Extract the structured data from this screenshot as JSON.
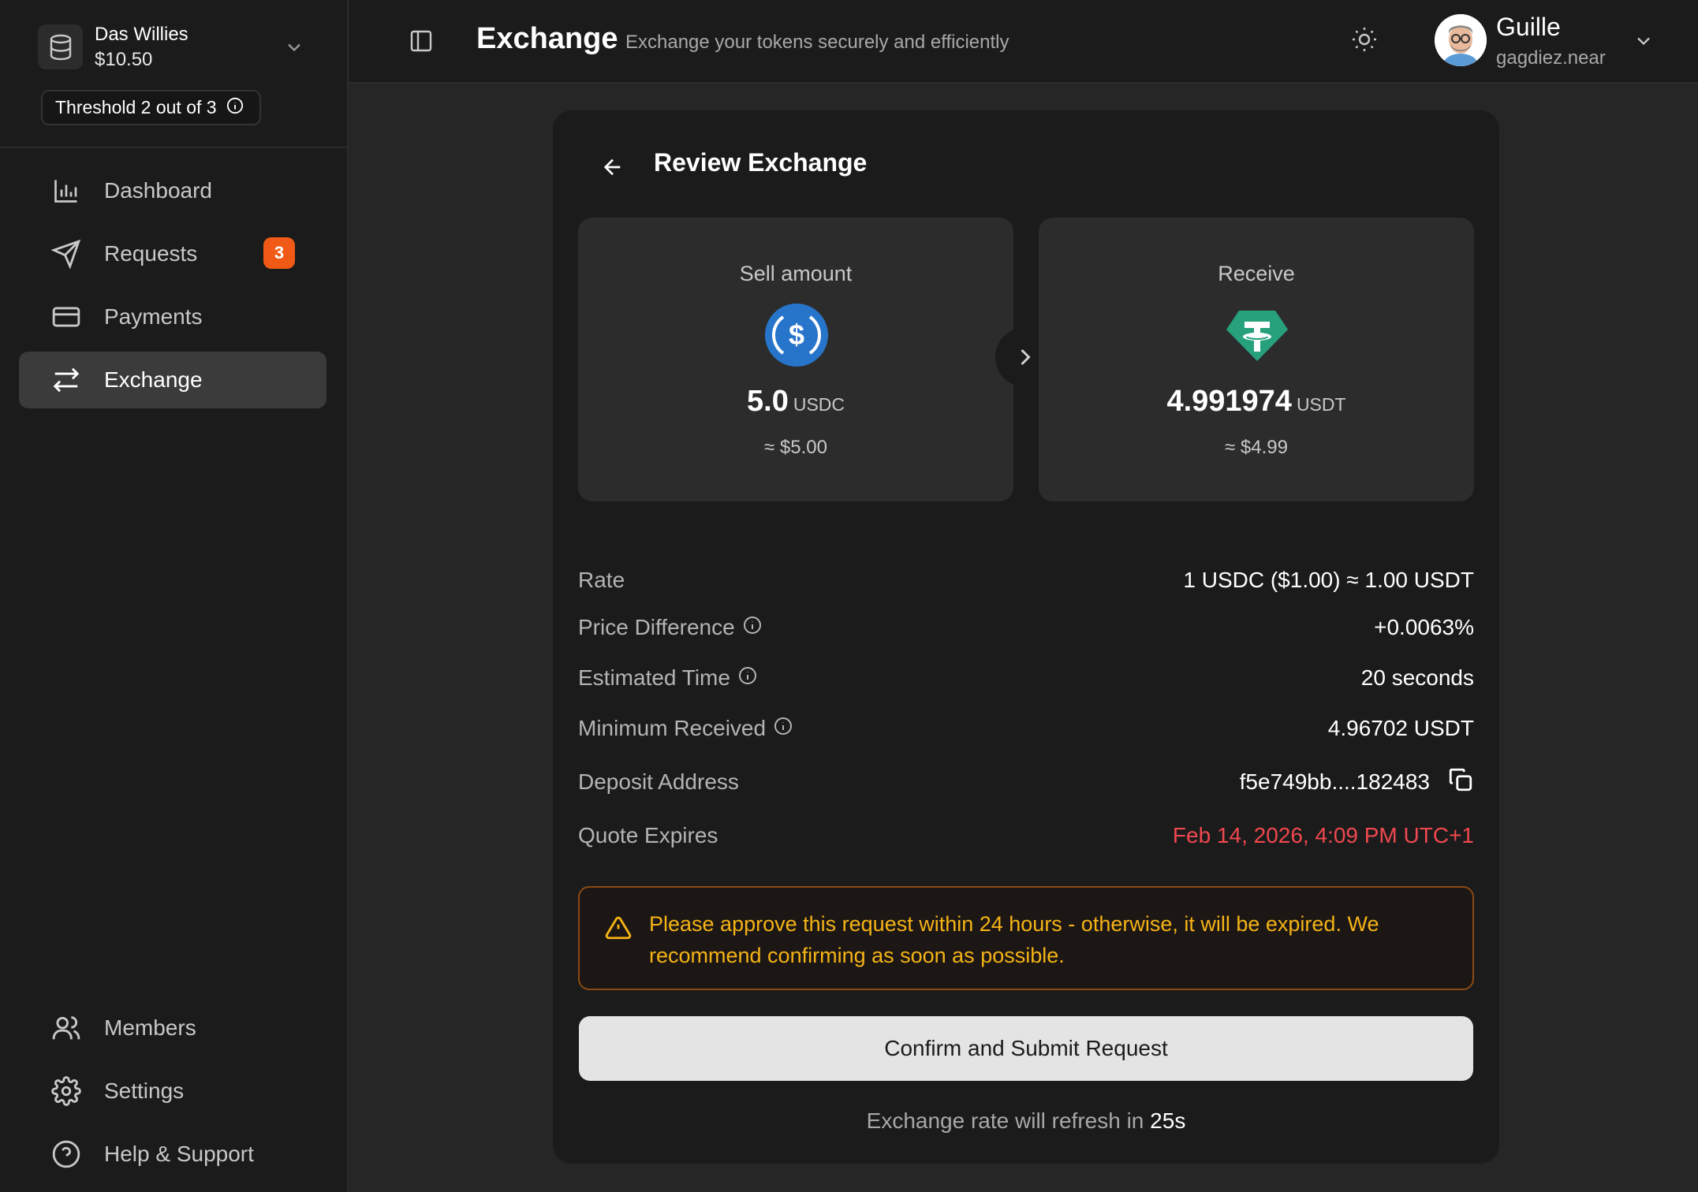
{
  "wallet": {
    "name": "Das Willies",
    "balance": "$10.50",
    "threshold": "Threshold 2 out of 3"
  },
  "sidebar": {
    "items": [
      {
        "label": "Dashboard",
        "icon": "bar-chart-icon"
      },
      {
        "label": "Requests",
        "icon": "send-icon",
        "badge": "3"
      },
      {
        "label": "Payments",
        "icon": "credit-card-icon"
      },
      {
        "label": "Exchange",
        "icon": "swap-arrows-icon",
        "active": true
      }
    ],
    "bottom_items": [
      {
        "label": "Members",
        "icon": "users-icon"
      },
      {
        "label": "Settings",
        "icon": "gear-icon"
      },
      {
        "label": "Help & Support",
        "icon": "help-circle-icon"
      }
    ]
  },
  "header": {
    "title": "Exchange",
    "subtitle": "Exchange your tokens securely and efficiently",
    "user_name": "Guille",
    "user_account": "gagdiez.near"
  },
  "review": {
    "title": "Review Exchange",
    "sell": {
      "label": "Sell amount",
      "amount": "5.0",
      "symbol": "USDC",
      "usd": "≈ $5.00",
      "color": "#2775ca"
    },
    "receive": {
      "label": "Receive",
      "amount": "4.991974",
      "symbol": "USDT",
      "usd": "≈ $4.99",
      "color": "#26a17b"
    },
    "details": {
      "rate_label": "Rate",
      "rate_value": "1 USDC ($1.00) ≈ 1.00 USDT",
      "price_diff_label": "Price Difference",
      "price_diff_value": "+0.0063%",
      "est_time_label": "Estimated Time",
      "est_time_value": "20 seconds",
      "min_received_label": "Minimum Received",
      "min_received_value": "4.96702 USDT",
      "deposit_label": "Deposit Address",
      "deposit_value": "f5e749bb....182483",
      "expires_label": "Quote Expires",
      "expires_value": "Feb 14, 2026, 4:09 PM UTC+1"
    },
    "warning": "Please approve this request within 24 hours - otherwise, it will be expired. We recommend confirming as soon as possible.",
    "confirm_label": "Confirm and Submit Request",
    "refresh_prefix": "Exchange rate will refresh in",
    "refresh_seconds": "25s"
  },
  "colors": {
    "accent_badge": "#f05a16",
    "expire_red": "#f0484e",
    "warning_yellow": "#f5b316"
  }
}
